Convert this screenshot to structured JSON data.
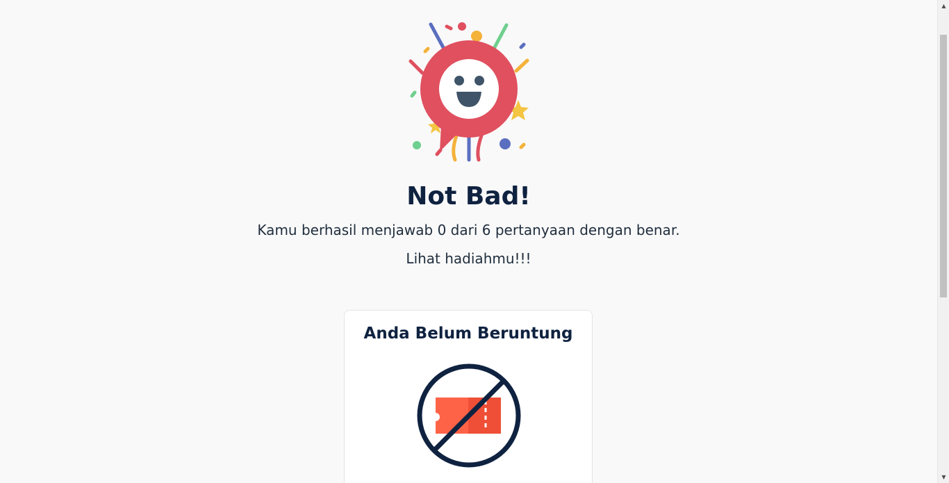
{
  "result": {
    "title": "Not Bad!",
    "message": "Kamu berhasil menjawab 0 dari 6 pertanyaan dengan benar.",
    "cta": "Lihat hadiahmu!!!"
  },
  "prize_card": {
    "title": "Anda Belum Beruntung",
    "icon": "no-ticket-icon"
  },
  "illustration": {
    "icon": "happy-face-celebration-icon"
  },
  "colors": {
    "background": "#f9f9f9",
    "title_text": "#0f2240",
    "accent_red": "#e0505f",
    "ticket_orange": "#ff6347",
    "prohibit_navy": "#0f2240"
  },
  "scrollbar": {
    "up_glyph": "▲",
    "down_glyph": "▼"
  }
}
